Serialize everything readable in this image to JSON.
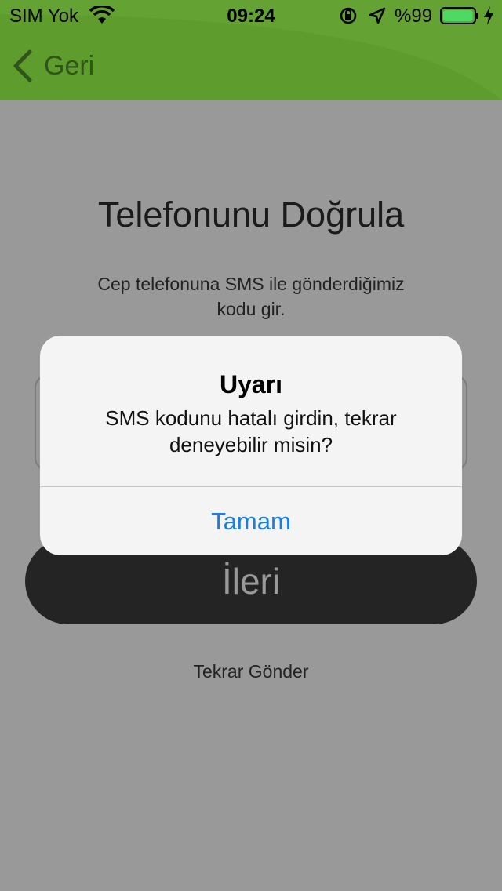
{
  "status_bar": {
    "carrier": "SIM Yok",
    "time": "09:24",
    "battery_percent": "%99",
    "battery_level": 0.99
  },
  "nav": {
    "back_label": "Geri"
  },
  "page": {
    "title": "Telefonunu Doğrula",
    "subtitle": "Cep telefonuna SMS ile gönderdiğimiz kodu gir.",
    "next_button": "İleri",
    "resend_link": "Tekrar Gönder"
  },
  "alert": {
    "title": "Uyarı",
    "message": "SMS kodunu hatalı girdin, tekrar deneyebilir misin?",
    "button": "Tamam"
  },
  "colors": {
    "header_green": "#5e9d2d",
    "alert_button_blue": "#1a7fe0",
    "battery_green": "#4cd964"
  }
}
